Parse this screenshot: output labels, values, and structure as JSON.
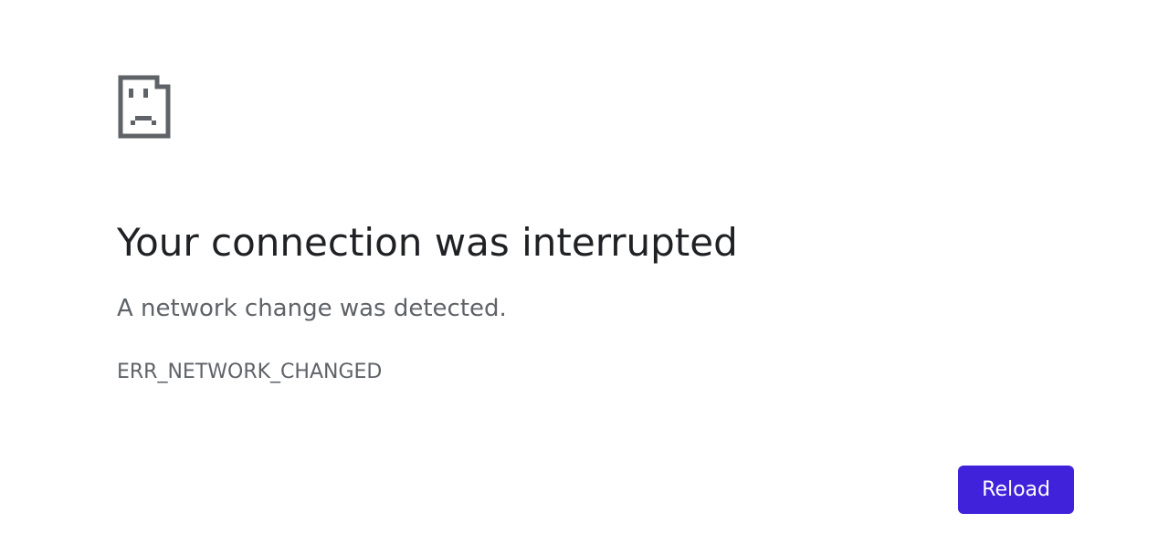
{
  "error": {
    "title": "Your connection was interrupted",
    "subtitle": "A network change was detected.",
    "code": "ERR_NETWORK_CHANGED"
  },
  "actions": {
    "reload_label": "Reload"
  },
  "colors": {
    "text_primary": "#202124",
    "text_secondary": "#5f6368",
    "accent": "#4022db"
  }
}
